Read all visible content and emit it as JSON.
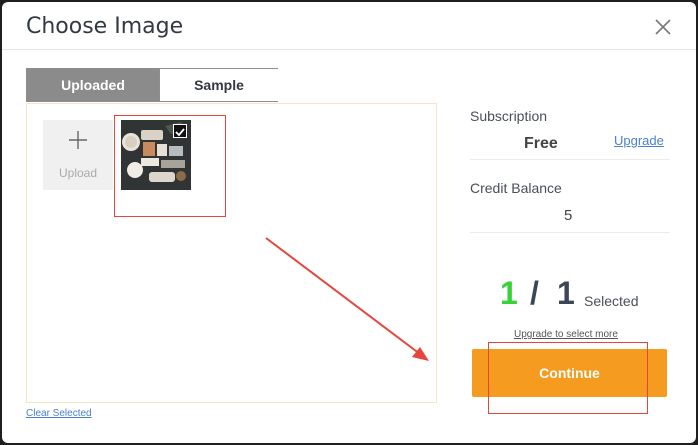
{
  "dialog": {
    "title": "Choose Image"
  },
  "tabs": {
    "uploaded": "Uploaded",
    "sample": "Sample"
  },
  "gallery": {
    "upload_label": "Upload",
    "selected_image_checked": true
  },
  "clear_selected": "Clear Selected",
  "subscription": {
    "label": "Subscription",
    "value": "Free",
    "upgrade_link": "Upgrade"
  },
  "credit": {
    "label": "Credit Balance",
    "value": "5"
  },
  "selection": {
    "current": "1",
    "separator": "/",
    "total": "1",
    "word": "Selected",
    "upgrade_more": "Upgrade to select more"
  },
  "continue_button": "Continue",
  "colors": {
    "accent": "#f59b1f",
    "count_green": "#37d237",
    "annotation_red": "#e8453c",
    "link_blue": "#4a7fd1"
  }
}
